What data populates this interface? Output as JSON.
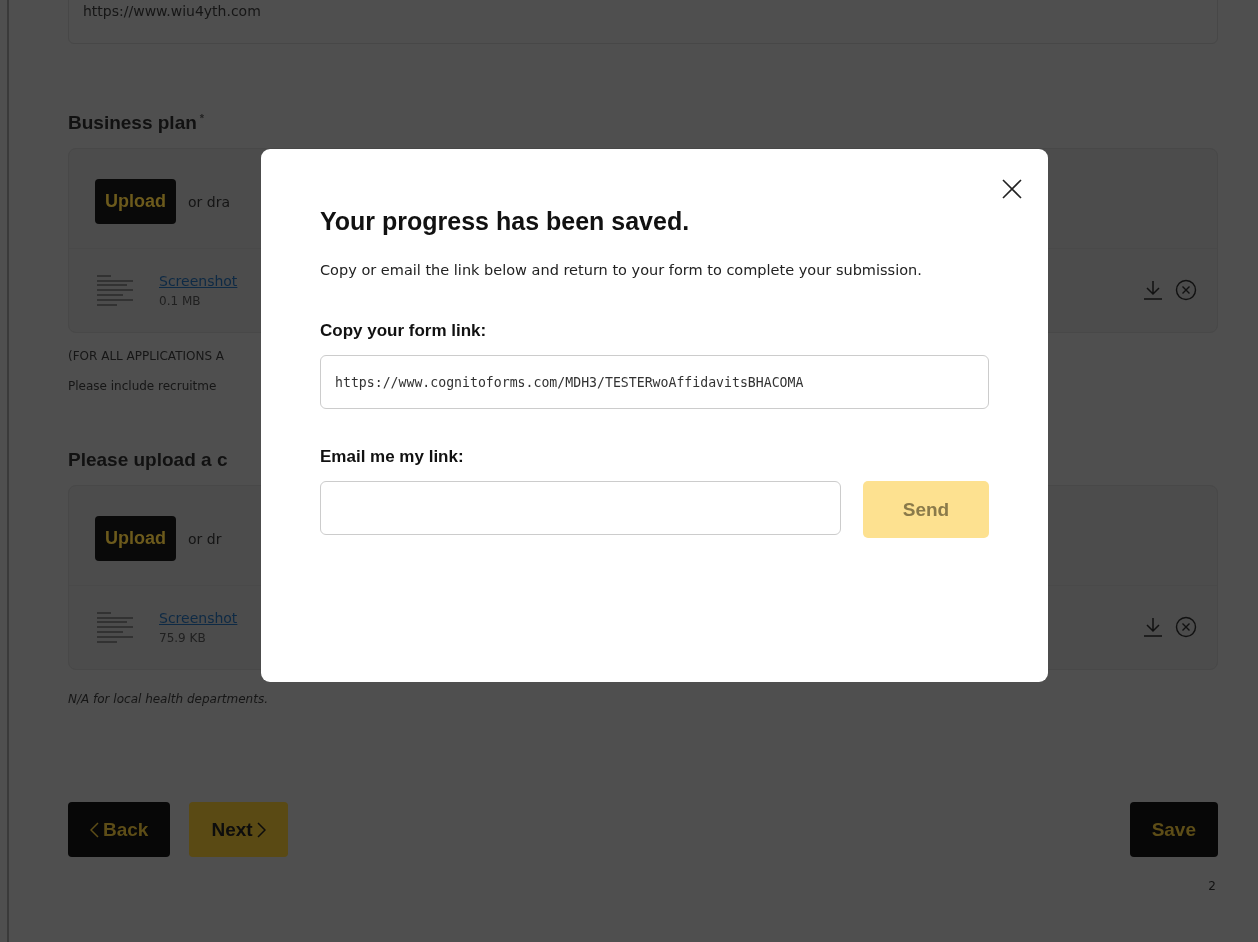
{
  "page": {
    "website_field": {
      "value": "https://www.wiu4yth.com"
    },
    "sections": [
      {
        "heading": "Business plan",
        "required_mark": "*",
        "upload": {
          "button": "Upload",
          "hint": "or dra"
        },
        "file": {
          "name": "Screenshot",
          "size": "0.1 MB"
        },
        "notes": [
          "(FOR ALL APPLICATIONS A",
          "Please include recruitme"
        ]
      },
      {
        "heading": "Please upload a c",
        "upload": {
          "button": "Upload",
          "hint": "or dr"
        },
        "file": {
          "name": "Screenshot",
          "size": "75.9 KB"
        },
        "italic_note": "N/A for local health departments."
      }
    ],
    "buttons": {
      "back": {
        "label": "Back"
      },
      "next": {
        "label": "Next"
      },
      "save": {
        "label": "Save"
      }
    },
    "page_number": "2"
  },
  "dialog": {
    "title": "Your progress has been saved.",
    "message": "Copy or email the link below and return to your form to complete your submission.",
    "link_label": "Copy your form link:",
    "link_field": {
      "value": "https://www.cognitoforms.com/MDH3/TESTERwoAffidavitsBHACOMA"
    },
    "email_label": "Email me my link:",
    "send_button": {
      "label": "Send",
      "disabled": true
    }
  }
}
